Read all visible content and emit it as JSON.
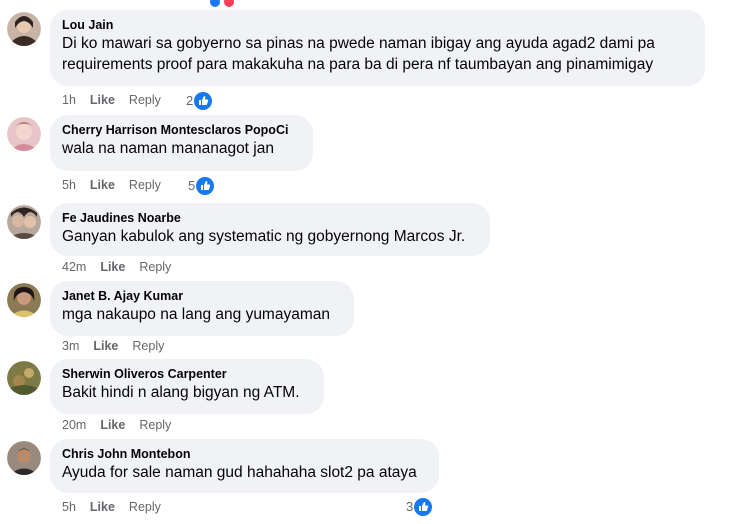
{
  "comments": [
    {
      "author": "Lou Jain",
      "text_lines": [
        "Di ko mawari sa gobyerno sa pinas na pwede naman ibigay ang ayuda agad2 dami pa",
        "requirements proof para makakuha na para ba di pera nf taumbayan ang pinamimigay"
      ],
      "time": "1h",
      "like": "Like",
      "reply": "Reply",
      "reactions": "2",
      "avatar_color": "#7a5a4a"
    },
    {
      "author": "Cherry Harrison Montesclaros PopoCi",
      "text_lines": [
        "wala na naman mananagot jan"
      ],
      "time": "5h",
      "like": "Like",
      "reply": "Reply",
      "reactions": "5",
      "avatar_color": "#d9a0a8"
    },
    {
      "author": "Fe Jaudines Noarbe",
      "text_lines": [
        "Ganyan kabulok ang systematic ng gobyernong Marcos Jr."
      ],
      "time": "42m",
      "like": "Like",
      "reply": "Reply",
      "reactions": "",
      "avatar_color": "#5b4b42"
    },
    {
      "author": "Janet B. Ajay Kumar",
      "text_lines": [
        "mga nakaupo na lang ang yumayaman"
      ],
      "time": "3m",
      "like": "Like",
      "reply": "Reply",
      "reactions": "",
      "avatar_color": "#3f2f2a"
    },
    {
      "author": "Sherwin Oliveros Carpenter",
      "text_lines": [
        "Bakit hindi n alang bigyan ng ATM."
      ],
      "time": "20m",
      "like": "Like",
      "reply": "Reply",
      "reactions": "",
      "avatar_color": "#6f6a3a"
    },
    {
      "author": "Chris John Montebon",
      "text_lines": [
        "Ayuda for sale naman gud hahahaha slot2 pa ataya"
      ],
      "time": "5h",
      "like": "Like",
      "reply": "Reply",
      "reactions": "3",
      "avatar_color": "#4a3528"
    }
  ],
  "icons": {
    "reaction": "like-thumb-icon"
  },
  "colors": {
    "bubble": "#f0f2f5",
    "meta": "#65676b",
    "like_blue": "#1877f2"
  }
}
